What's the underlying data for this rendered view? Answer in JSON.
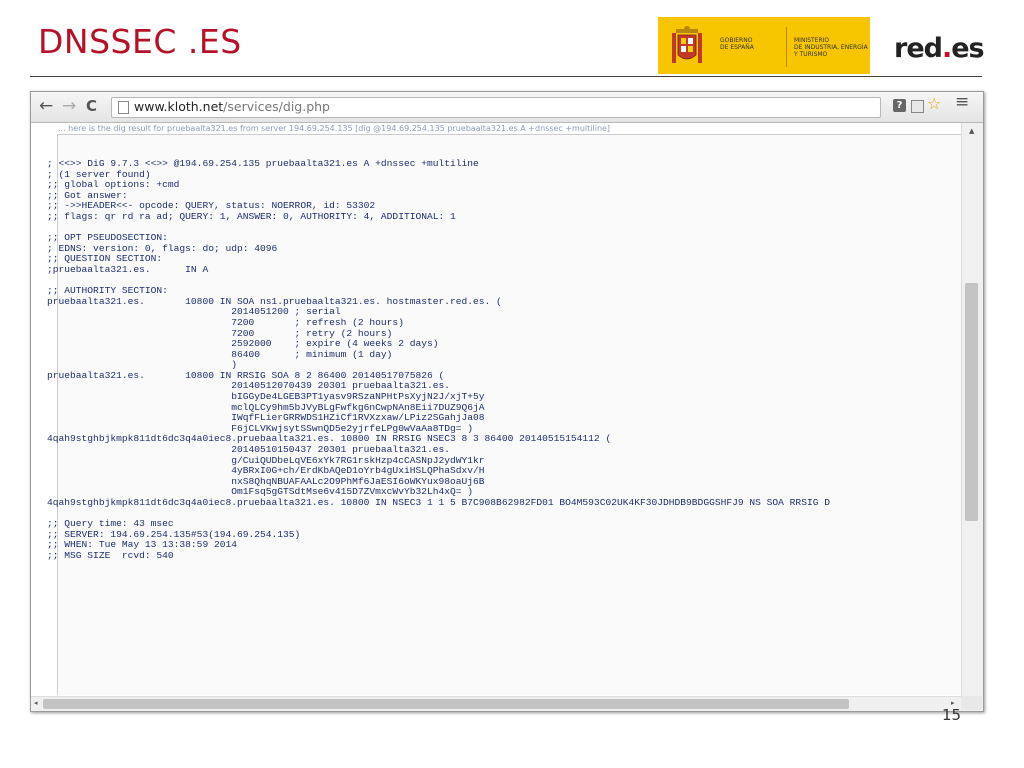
{
  "slide": {
    "title": "DNSSEC .ES",
    "page_number": "15"
  },
  "logos": {
    "gobierno_text": "GOBIERNO\nDE ESPAÑA",
    "ministerio_text": "MINISTERIO\nDE INDUSTRIA, ENERGÍA\nY TURISMO",
    "redes_main": "red",
    "redes_dot": ".",
    "redes_suffix": "es"
  },
  "browser": {
    "back_icon": "←",
    "forward_icon": "→",
    "reload_icon": "C",
    "url_host": "www.kloth.net",
    "url_path": "/services/dig.php",
    "help_icon": "?",
    "star_icon": "☆",
    "menu_icon": "≡",
    "cut_off_header": "... here is the dig result for pruebaalta321.es from server 194.69.254.135 [dig @194.69.254.135 pruebaalta321.es A +dnssec +multiline]"
  },
  "dig_output": "; <<>> DiG 9.7.3 <<>> @194.69.254.135 pruebaalta321.es A +dnssec +multiline\n; (1 server found)\n;; global options: +cmd\n;; Got answer:\n;; ->>HEADER<<- opcode: QUERY, status: NOERROR, id: 53302\n;; flags: qr rd ra ad; QUERY: 1, ANSWER: 0, AUTHORITY: 4, ADDITIONAL: 1\n\n;; OPT PSEUDOSECTION:\n; EDNS: version: 0, flags: do; udp: 4096\n;; QUESTION SECTION:\n;pruebaalta321.es.      IN A\n\n;; AUTHORITY SECTION:\npruebaalta321.es.       10800 IN SOA ns1.pruebaalta321.es. hostmaster.red.es. (\n                                2014051200 ; serial\n                                7200       ; refresh (2 hours)\n                                7200       ; retry (2 hours)\n                                2592000    ; expire (4 weeks 2 days)\n                                86400      ; minimum (1 day)\n                                )\npruebaalta321.es.       10800 IN RRSIG SOA 8 2 86400 20140517075826 (\n                                20140512070439 20301 pruebaalta321.es.\n                                bIGGyDe4LGEB3PT1yasv9RSzaNPHtPsXyjN2J/xjT+5y\n                                mclQLCy9hm5bJVyBLgFwfkg6nCwpNAn8Eii7DUZ9Q6jA\n                                IWqfFLierGRRWDS1HZiCf1RVXzxaw/LPiz2SGahjJa08\n                                F6jCLVKwjsytSSwnQD5e2yjrfeLPg0wVaAa8TDg= )\n4qah9stghbjkmpk811dt6dc3q4a0iec8.pruebaalta321.es. 10800 IN RRSIG NSEC3 8 3 86400 20140515154112 (\n                                20140510150437 20301 pruebaalta321.es.\n                                g/CuiQUDbeLqVE6xYk7RG1rskHzp4cCASNpJ2ydWY1kr\n                                4yBRxI0G+ch/ErdKbAQeD1oYrb4gUxiHSLQPhaSdxv/H\n                                nxS8QhqNBUAFAALc2O9PhMf6JaESI6oWKYux98oaUj6B\n                                Om1Fsq5gGTSdtMse6v415D7ZVmxcWvYb32Lh4xQ= )\n4qah9stghbjkmpk811dt6dc3q4a0iec8.pruebaalta321.es. 10800 IN NSEC3 1 1 5 B7C908B62982FD01 BO4M593C02UK4KF30JDHDB9BDGGSHFJ9 NS SOA RRSIG D\n\n;; Query time: 43 msec\n;; SERVER: 194.69.254.135#53(194.69.254.135)\n;; WHEN: Tue May 13 13:38:59 2014\n;; MSG SIZE  rcvd: 540",
  "colors": {
    "title": "#b5122a",
    "logo_yellow": "#f7c600",
    "output_text": "#1e2e6e"
  }
}
